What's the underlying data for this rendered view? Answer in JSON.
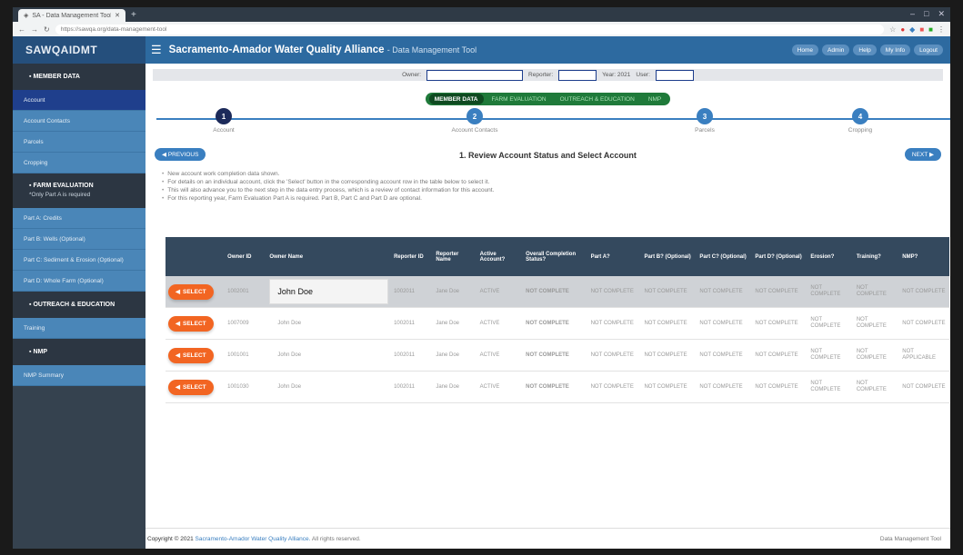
{
  "browser": {
    "tab_title": "SA - Data Management Tool",
    "new_tab": "+",
    "url": "https://sawqa.org/data-management-tool"
  },
  "header": {
    "logo": "SAWQAIDMT",
    "title": "Sacramento-Amador Water Quality Alliance",
    "subtitle": "- Data Management Tool",
    "buttons": [
      "Home",
      "Admin",
      "Help",
      "My Info",
      "Logout"
    ]
  },
  "sidebar": {
    "member_section": "MEMBER DATA",
    "member_items": [
      "Account",
      "Account Contacts",
      "Parcels",
      "Cropping"
    ],
    "farm_section": "FARM EVALUATION",
    "farm_note": "*Only Part A is required",
    "farm_items": [
      "Part A: Credits",
      "Part B: Wells (Optional)",
      "Part C: Sediment & Erosion (Optional)",
      "Part D: Whole Farm (Optional)"
    ],
    "outreach_section": "OUTREACH & EDUCATION",
    "outreach_items": [
      "Training"
    ],
    "nmp_section": "NMP",
    "nmp_items": [
      "NMP Summary"
    ]
  },
  "filters": {
    "owner_label": "Owner:",
    "reporter_label": "Reporter:",
    "year_label": "Year: 2021",
    "user_label": "User:"
  },
  "pills": [
    "MEMBER DATA",
    "FARM EVALUATION",
    "OUTREACH & EDUCATION",
    "NMP"
  ],
  "steps": [
    {
      "num": "1",
      "label": "Account"
    },
    {
      "num": "2",
      "label": "Account Contacts"
    },
    {
      "num": "3",
      "label": "Parcels"
    },
    {
      "num": "4",
      "label": "Cropping"
    }
  ],
  "page": {
    "previous": "PREVIOUS",
    "next": "NEXT",
    "title": "1. Review Account Status and Select Account"
  },
  "instructions": [
    "New account work completion data shown.",
    "For details on an individual account, click the 'Select' button in the corresponding account row in the table below to select it.",
    "This will also advance you to the next step in the data entry process, which is a review of contact information for this account.",
    "For this reporting year, Farm Evaluation Part A is required. Part B, Part C and Part D are optional."
  ],
  "table": {
    "headers": [
      "",
      "Owner ID",
      "Owner Name",
      "Reporter ID",
      "Reporter Name",
      "Active Account?",
      "Overall Completion Status?",
      "Part A?",
      "Part B? (Optional)",
      "Part C? (Optional)",
      "Part D? (Optional)",
      "Erosion?",
      "Training?",
      "NMP?"
    ],
    "select_label": "SELECT",
    "rows": [
      {
        "owner_id": "1002001",
        "owner_name": "John Doe",
        "reporter_id": "1002011",
        "reporter_name": "Jane Doe",
        "active": "ACTIVE",
        "overall": "NOT COMPLETE",
        "cells": [
          "NOT COMPLETE",
          "NOT COMPLETE",
          "NOT COMPLETE",
          "NOT COMPLETE",
          "NOT COMPLETE",
          "NOT COMPLETE",
          "NOT COMPLETE"
        ]
      },
      {
        "owner_id": "1007009",
        "owner_name": "John Doe",
        "reporter_id": "1002011",
        "reporter_name": "Jane Doe",
        "active": "ACTIVE",
        "overall": "NOT COMPLETE",
        "cells": [
          "NOT COMPLETE",
          "NOT COMPLETE",
          "NOT COMPLETE",
          "NOT COMPLETE",
          "NOT COMPLETE",
          "NOT COMPLETE",
          "NOT COMPLETE"
        ]
      },
      {
        "owner_id": "1001001",
        "owner_name": "John Doe",
        "reporter_id": "1002011",
        "reporter_name": "Jane Doe",
        "active": "ACTIVE",
        "overall": "NOT COMPLETE",
        "cells": [
          "NOT COMPLETE",
          "NOT COMPLETE",
          "NOT COMPLETE",
          "NOT COMPLETE",
          "NOT COMPLETE",
          "NOT COMPLETE",
          "NOT APPLICABLE"
        ]
      },
      {
        "owner_id": "1001030",
        "owner_name": "John Doe",
        "reporter_id": "1002011",
        "reporter_name": "Jane Doe",
        "active": "ACTIVE",
        "overall": "NOT COMPLETE",
        "cells": [
          "NOT COMPLETE",
          "NOT COMPLETE",
          "NOT COMPLETE",
          "NOT COMPLETE",
          "NOT COMPLETE",
          "NOT COMPLETE",
          "NOT COMPLETE"
        ]
      }
    ]
  },
  "footer": {
    "copyright": "Copyright © 2021",
    "org": "Sacramento-Amador Water Quality Alliance.",
    "rights": "All rights reserved.",
    "right": "Data Management Tool"
  }
}
